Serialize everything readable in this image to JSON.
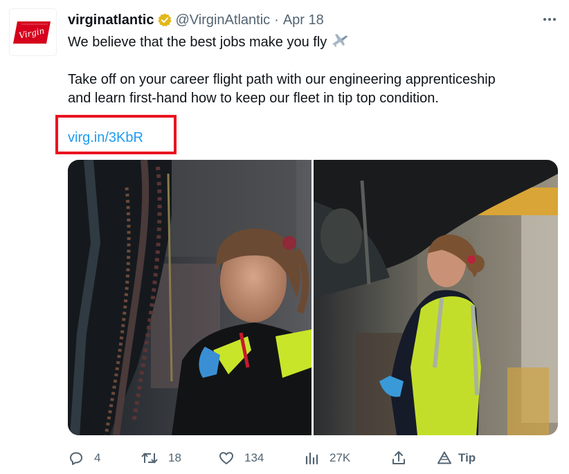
{
  "tweet": {
    "display_name": "virginatlantic",
    "handle": "@VirginAtlantic",
    "separator": "·",
    "date": "Apr 18",
    "avatar_logo_text": "Virgin",
    "text_line1": "We believe that the best jobs make you fly",
    "emoji_icon": "airplane-icon",
    "text_line2": "Take off on your career flight path with our engineering apprenticeship",
    "text_line3": "and learn first-hand how to keep our fleet in tip top condition.",
    "link": "virg.in/3KbR"
  },
  "actions": {
    "reply_count": "4",
    "retweet_count": "18",
    "like_count": "134",
    "view_count": "27K",
    "tip_label": "Tip"
  },
  "colors": {
    "link": "#1d9bf0",
    "highlight_border": "#e8141f",
    "muted": "#536471",
    "brand_red": "#d6001c",
    "verified_gold": "#e2b719"
  }
}
